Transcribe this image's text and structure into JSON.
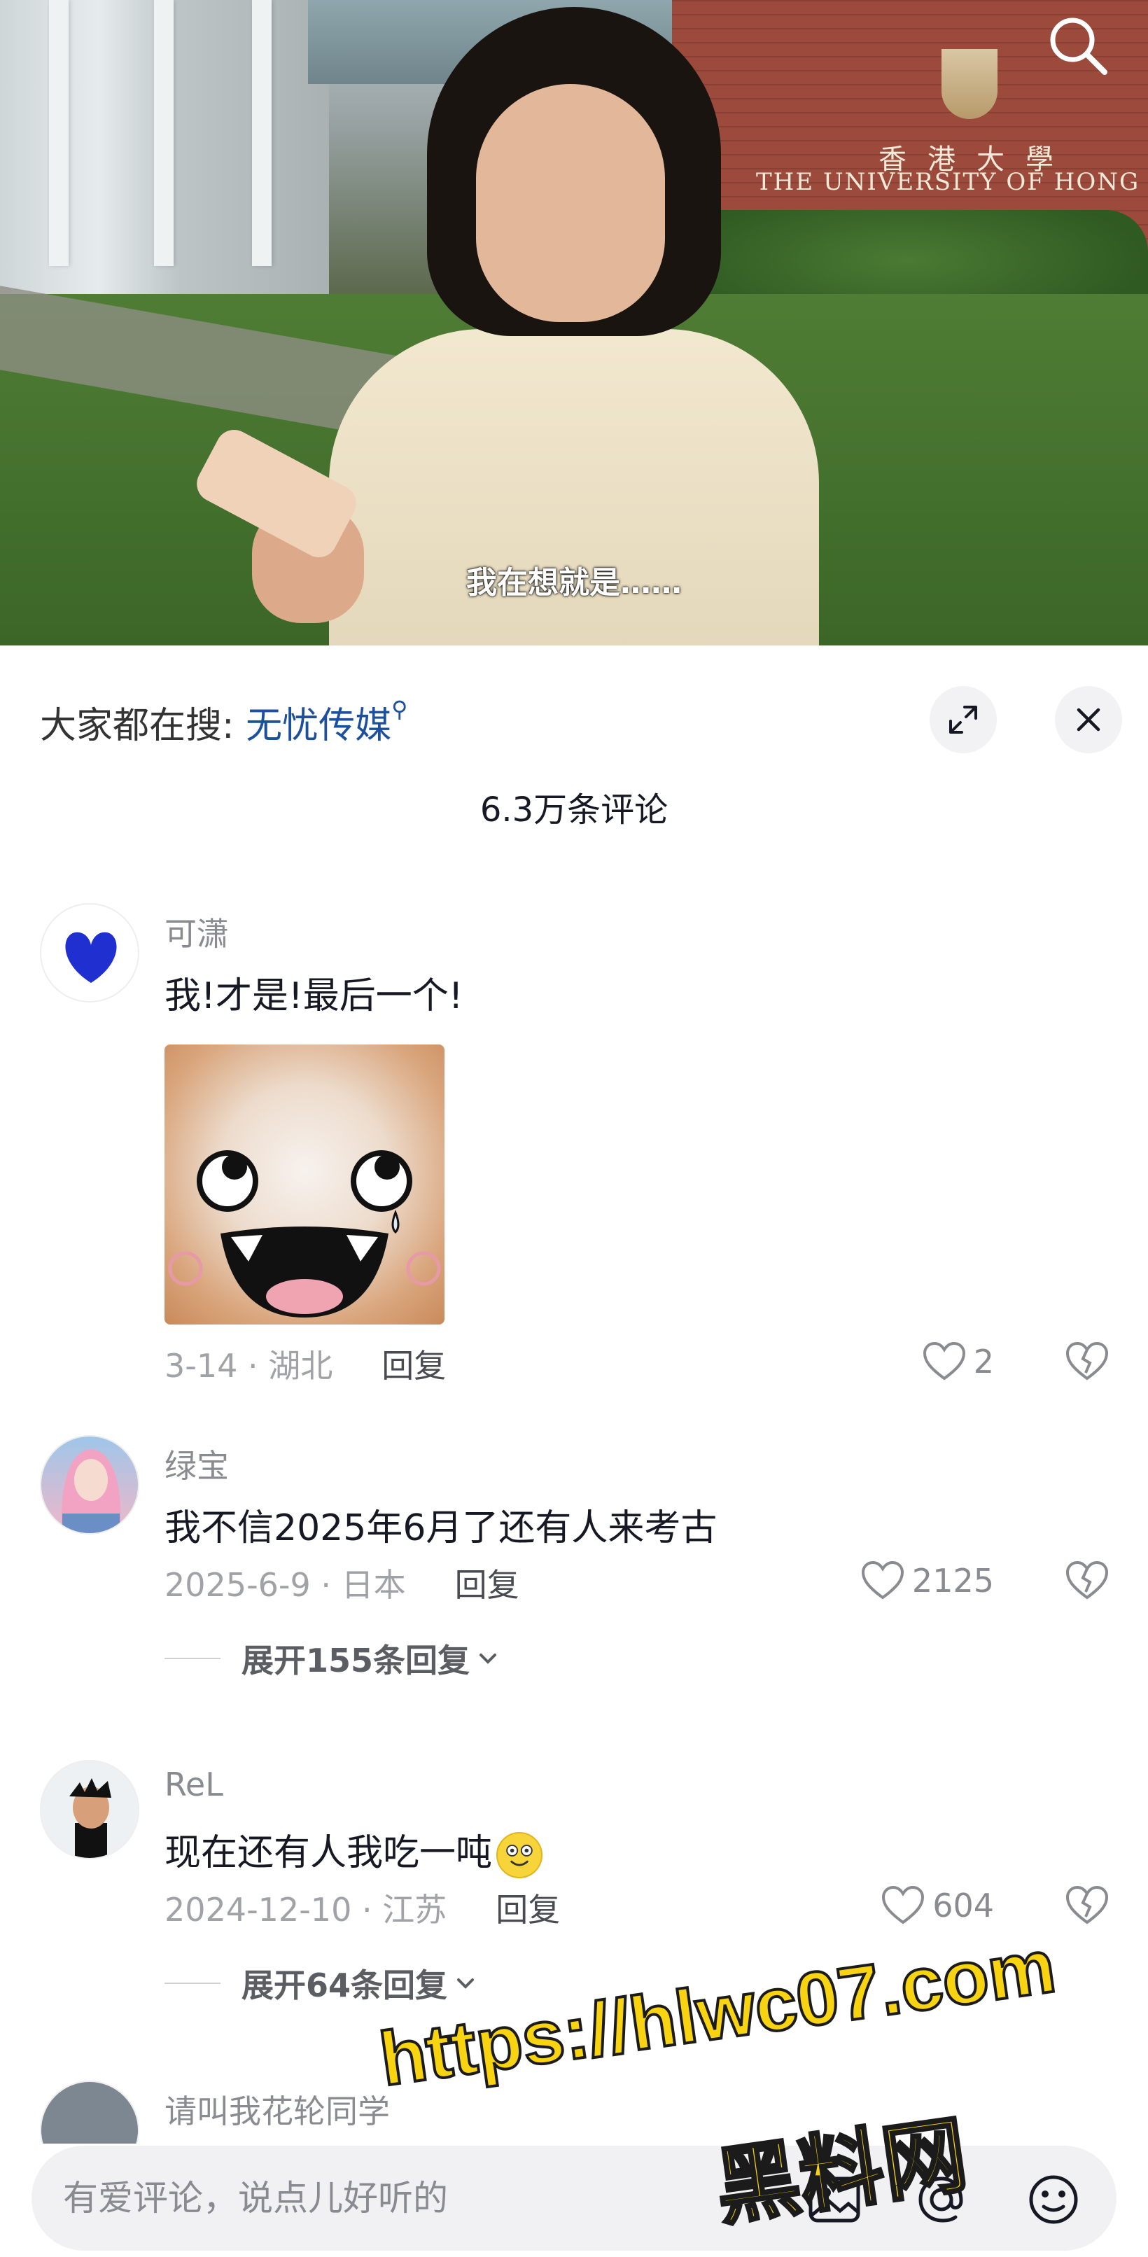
{
  "video": {
    "subtitle": "我在想就是……",
    "sign_cn": "香港大學",
    "sign_en": "THE UNIVERSITY OF HONG"
  },
  "sheet": {
    "hot_search_prefix": "大家都在搜:",
    "hot_search_term": "无忧传媒",
    "comment_count": "6.3万条评论"
  },
  "comments": [
    {
      "username": "可潇",
      "text": "我!才是!最后一个!",
      "date_location": "3-14 · 湖北",
      "reply_label": "回复",
      "likes": "2"
    },
    {
      "username": "绿宝",
      "text": "我不信2025年6月了还有人来考古",
      "date_location": "2025-6-9 · 日本",
      "reply_label": "回复",
      "likes": "2125",
      "expand_label": "展开155条回复"
    },
    {
      "username": "ReL",
      "text": "现在还有人我吃一吨",
      "date_location": "2024-12-10 · 江苏",
      "reply_label": "回复",
      "likes": "604",
      "expand_label": "展开64条回复"
    },
    {
      "username": "请叫我花轮同学"
    }
  ],
  "input": {
    "placeholder": "有爱评论，说点儿好听的"
  },
  "watermark": {
    "url": "https://hlwc07.com",
    "name": "黑料网"
  },
  "colors": {
    "link": "#1c4f9c",
    "watermark": "#f7d312"
  }
}
